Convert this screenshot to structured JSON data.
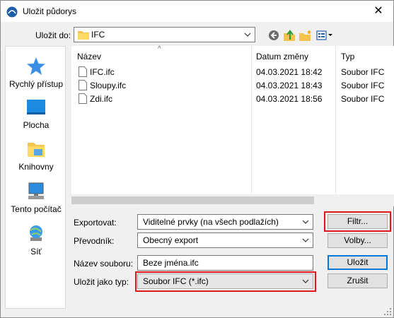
{
  "window": {
    "title": "Uložit půdorys",
    "close_glyph": "✕"
  },
  "location": {
    "label": "Uložit do:",
    "folder": "IFC"
  },
  "toolbar": {
    "icons": [
      "back-icon",
      "up-folder-icon",
      "new-folder-icon",
      "view-menu-icon"
    ]
  },
  "places": [
    {
      "label": "Rychlý přístup",
      "icon": "star-icon"
    },
    {
      "label": "Plocha",
      "icon": "desktop-icon"
    },
    {
      "label": "Knihovny",
      "icon": "libraries-icon"
    },
    {
      "label": "Tento počítač",
      "icon": "computer-icon"
    },
    {
      "label": "Síť",
      "icon": "network-icon"
    }
  ],
  "filelist": {
    "columns": [
      "Název",
      "Datum změny",
      "Typ"
    ],
    "sort_glyph": "^",
    "rows": [
      {
        "name": "IFC.ifc",
        "date": "04.03.2021 18:42",
        "type": "Soubor IFC"
      },
      {
        "name": "Sloupy.ifc",
        "date": "04.03.2021 18:43",
        "type": "Soubor IFC"
      },
      {
        "name": "Zdi.ifc",
        "date": "04.03.2021 18:56",
        "type": "Soubor IFC"
      }
    ]
  },
  "form": {
    "export_label": "Exportovat:",
    "export_value": "Viditelné prvky (na všech podlažích)",
    "translator_label": "Převodník:",
    "translator_value": "Obecný export",
    "filename_label": "Název souboru:",
    "filename_value": "Beze jména.ifc",
    "filetype_label": "Uložit jako typ:",
    "filetype_value": "Soubor IFC (*.ifc)"
  },
  "buttons": {
    "filter": "Filtr...",
    "options": "Volby...",
    "save": "Uložit",
    "cancel": "Zrušit"
  },
  "colors": {
    "highlight": "#e0161d",
    "accent": "#0078d7"
  }
}
